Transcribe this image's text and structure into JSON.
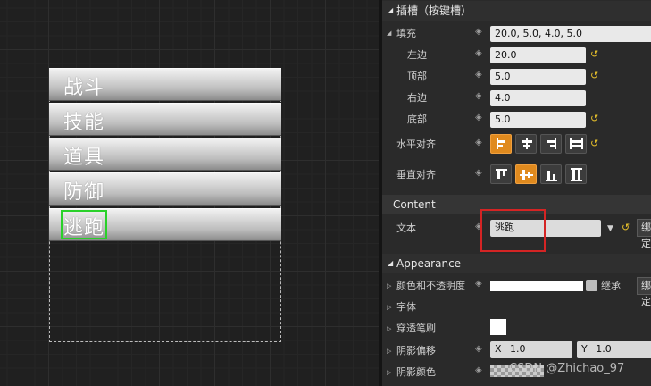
{
  "canvas": {
    "menu_items": [
      "战斗",
      "技能",
      "道具",
      "防御",
      "逃跑"
    ],
    "selected_item": "逃跑"
  },
  "slot_section": {
    "title": "插槽（按键槽）",
    "padding_label": "填充",
    "padding_value": "20.0, 5.0, 4.0, 5.0",
    "left_label": "左边",
    "left_value": "20.0",
    "top_label": "顶部",
    "top_value": "5.0",
    "right_label": "右边",
    "right_value": "4.0",
    "bottom_label": "底部",
    "bottom_value": "5.0",
    "halign_label": "水平对齐",
    "valign_label": "垂直对齐"
  },
  "content_section": {
    "title": "Content",
    "text_label": "文本",
    "text_value": "逃跑",
    "bind_label": "绑定"
  },
  "appearance_section": {
    "title": "Appearance",
    "color_label": "颜色和不透明度",
    "inherit_label": "继承",
    "bind_label": "绑定",
    "font_label": "字体",
    "strike_label": "穿透笔刷",
    "shadow_offset_label": "阴影偏移",
    "shadow_offset_x_prefix": "X",
    "shadow_offset_x": "1.0",
    "shadow_offset_y_prefix": "Y",
    "shadow_offset_y": "1.0",
    "shadow_color_label": "阴影颜色"
  },
  "watermark": "CSDN @Zhichao_97",
  "colors": {
    "active_align": "#e08a1e",
    "selection_outline": "#2ad12a",
    "highlight_box": "#d42424",
    "reset_arrow": "#e8c12a"
  }
}
